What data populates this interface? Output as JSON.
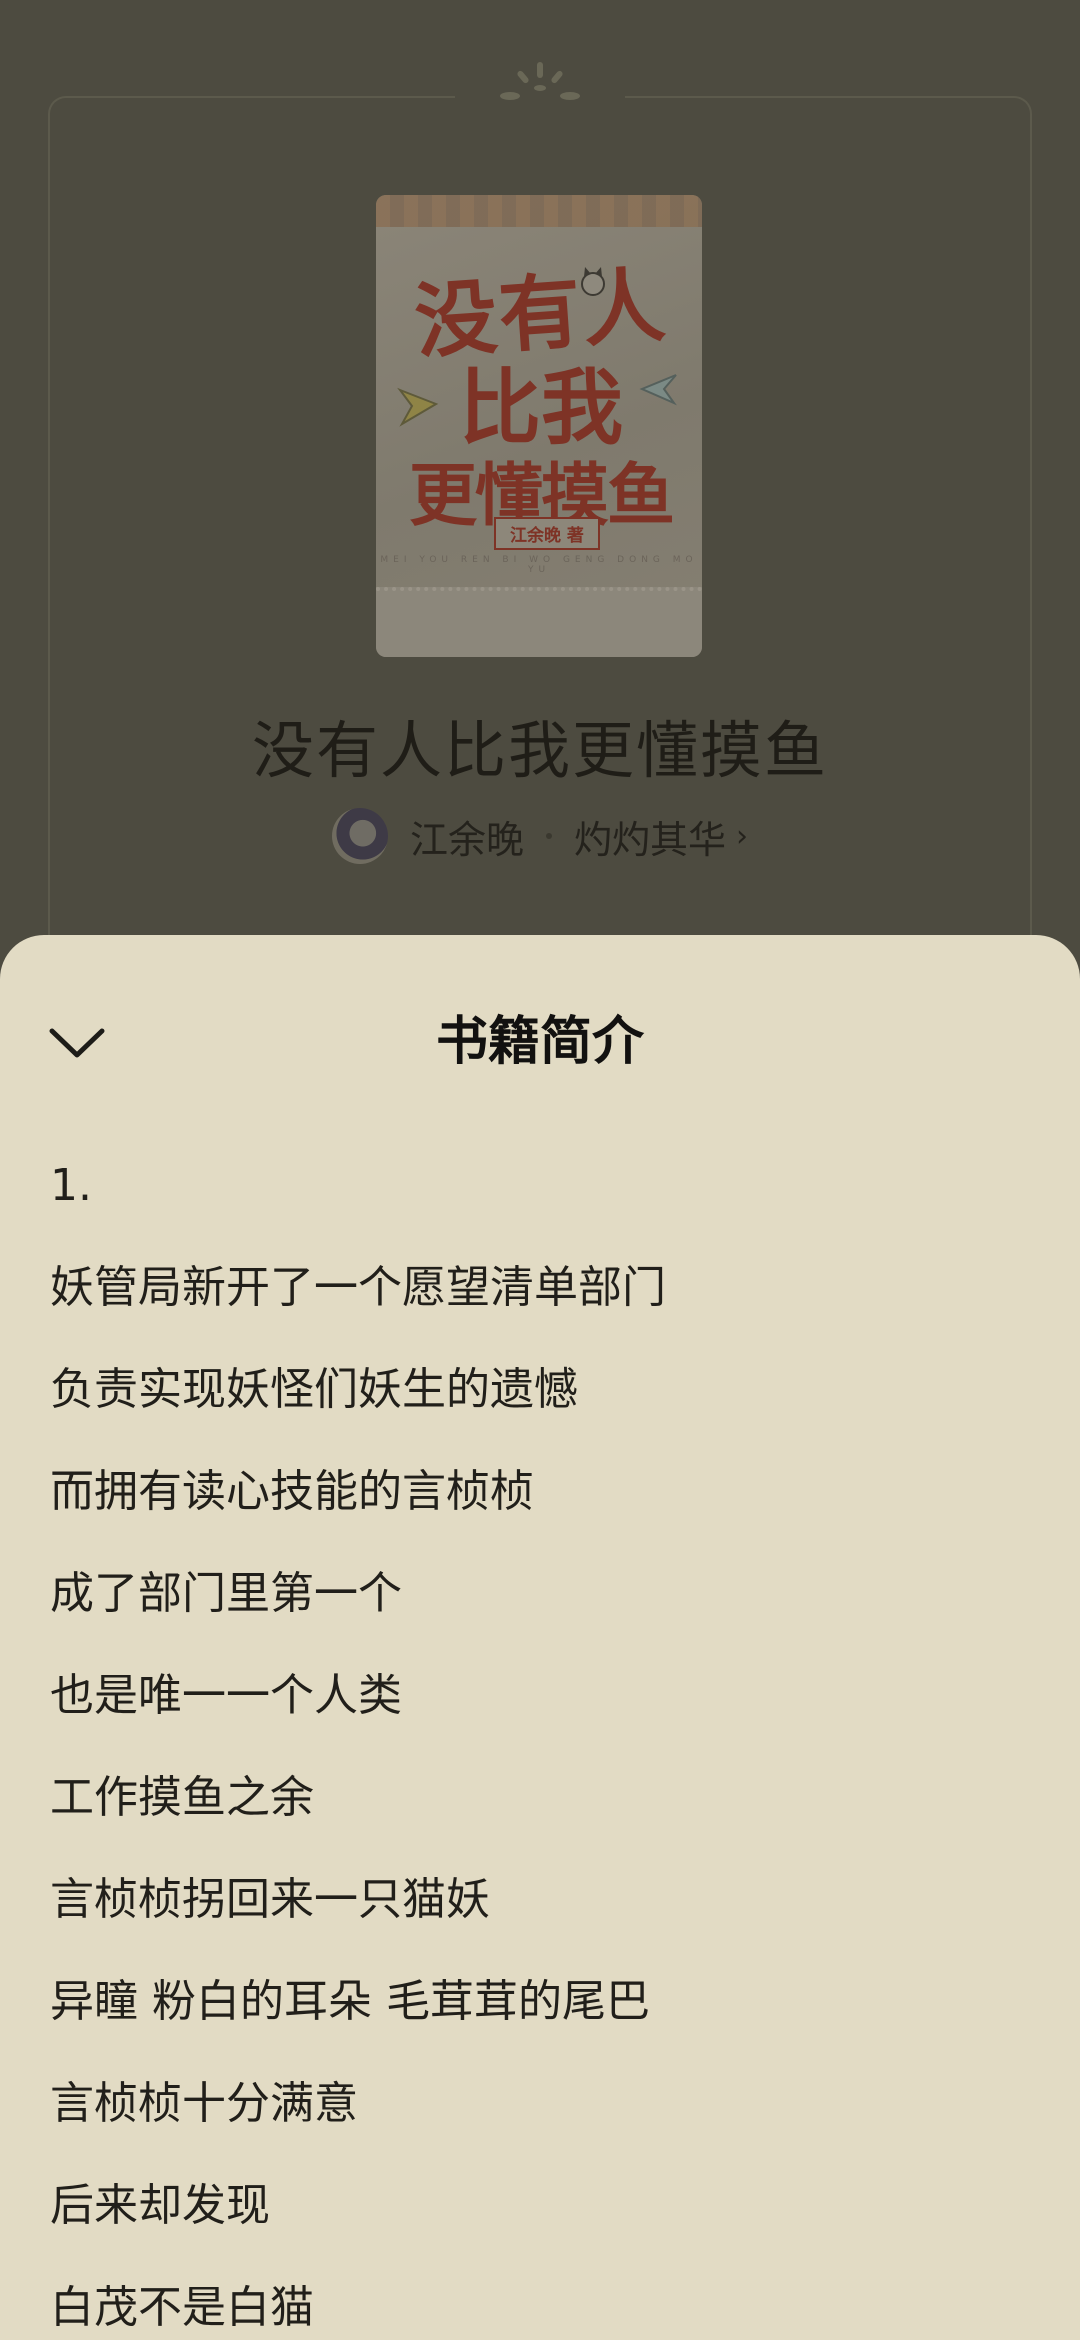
{
  "book": {
    "title": "没有人比我更懂摸鱼",
    "cover": {
      "title_line1": "没有人",
      "title_line2": "比我",
      "title_line3": "更懂摸鱼",
      "author_tag": "江余晚 著",
      "pinyin": "MEI YOU REN BI WO GENG DONG MO YU"
    },
    "author": "江余晚",
    "publisher": "灼灼其华",
    "publisher_chevron": "›"
  },
  "sheet": {
    "title": "书籍简介",
    "intro_lines": [
      "1.",
      "妖管局新开了一个愿望清单部门",
      "负责实现妖怪们妖生的遗憾",
      "而拥有读心技能的言桢桢",
      "成了部门里第一个",
      "也是唯一一个人类",
      "工作摸鱼之余",
      "言桢桢拐回来一只猫妖",
      "异瞳 粉白的耳朵 毛茸茸的尾巴",
      "言桢桢十分满意",
      "后来却发现",
      "白茂不是白猫"
    ]
  },
  "colors": {
    "overlay_background": "#4d4b40",
    "sheet_background": "#e2dbc4",
    "cover_title": "#7e3326"
  },
  "icons": {
    "close": "chevron-down-icon",
    "ornament": "sparkle-ornament-icon"
  }
}
